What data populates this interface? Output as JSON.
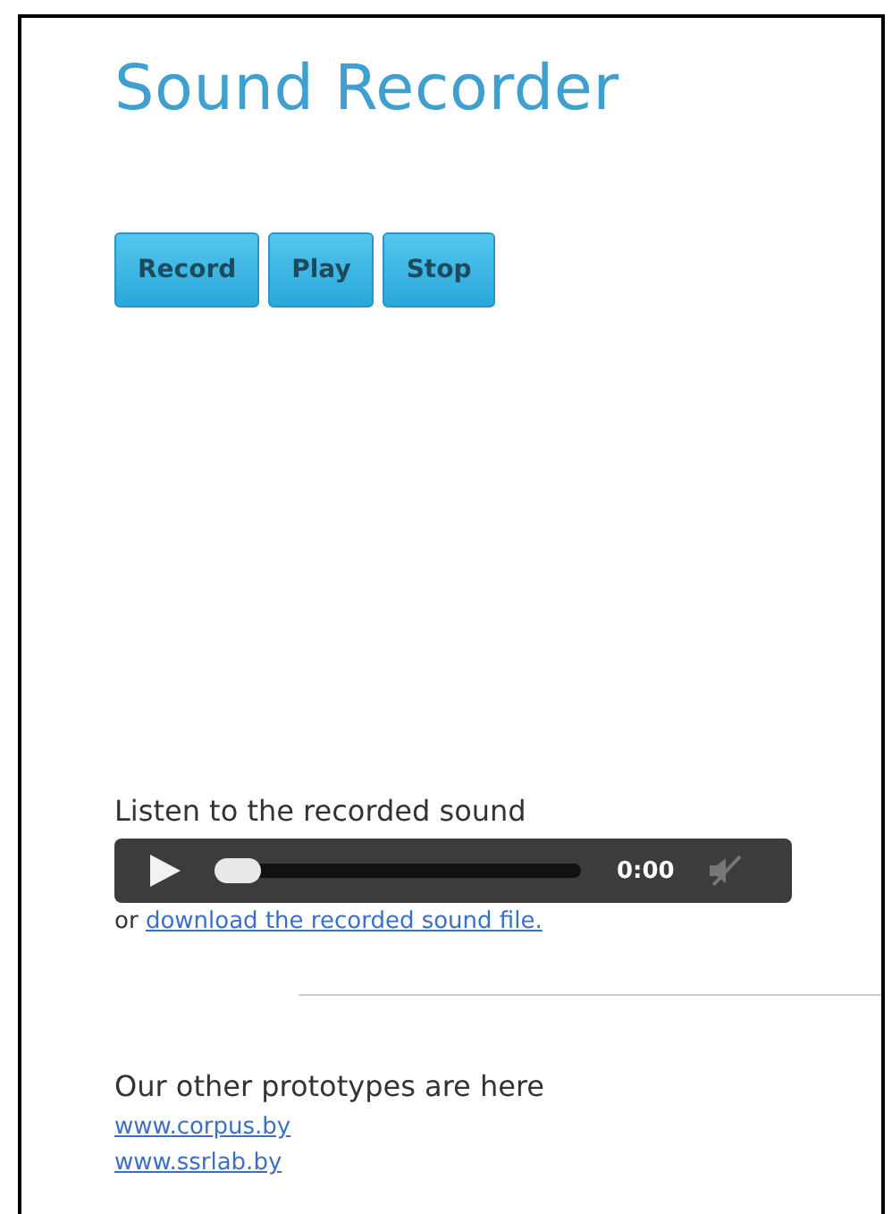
{
  "title": "Sound Recorder",
  "buttons": [
    "Record",
    "Play",
    "Stop"
  ],
  "listen": {
    "heading": "Listen to the recorded sound",
    "player": {
      "time": "0:00",
      "level": 0,
      "muted": true
    },
    "note_prefix": "or",
    "download_link": "download the recorded sound file."
  },
  "other": {
    "heading": "Our other prototypes are here",
    "links": [
      "www.corpus.by",
      "www.ssrlab.by"
    ]
  }
}
